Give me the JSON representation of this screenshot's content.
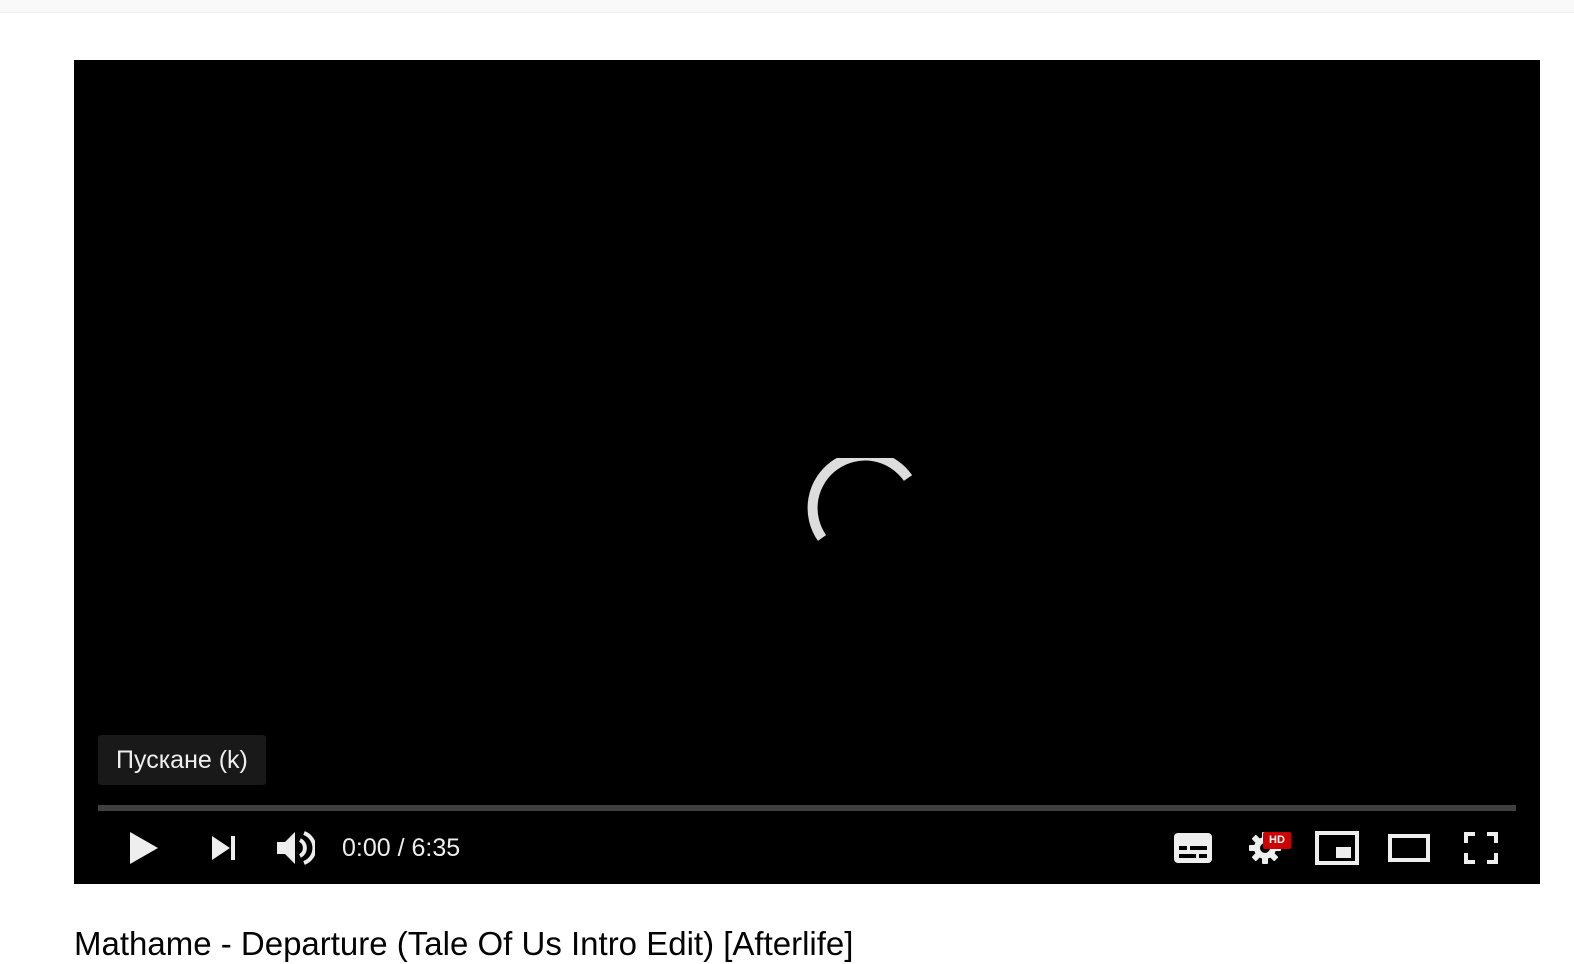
{
  "player": {
    "tooltip": "Пускане (k)",
    "time": "0:00 / 6:35",
    "progress": 0,
    "hd_badge": "HD",
    "icons": [
      "play-icon",
      "next-icon",
      "volume-icon",
      "subtitles-icon",
      "settings-icon",
      "miniplayer-icon",
      "theater-mode-icon",
      "fullscreen-icon"
    ],
    "spinner_color": "#dddddd",
    "hd_color": "#cc0000"
  },
  "video": {
    "title": "Mathame - Departure (Tale Of Us Intro Edit) [Afterlife]"
  }
}
